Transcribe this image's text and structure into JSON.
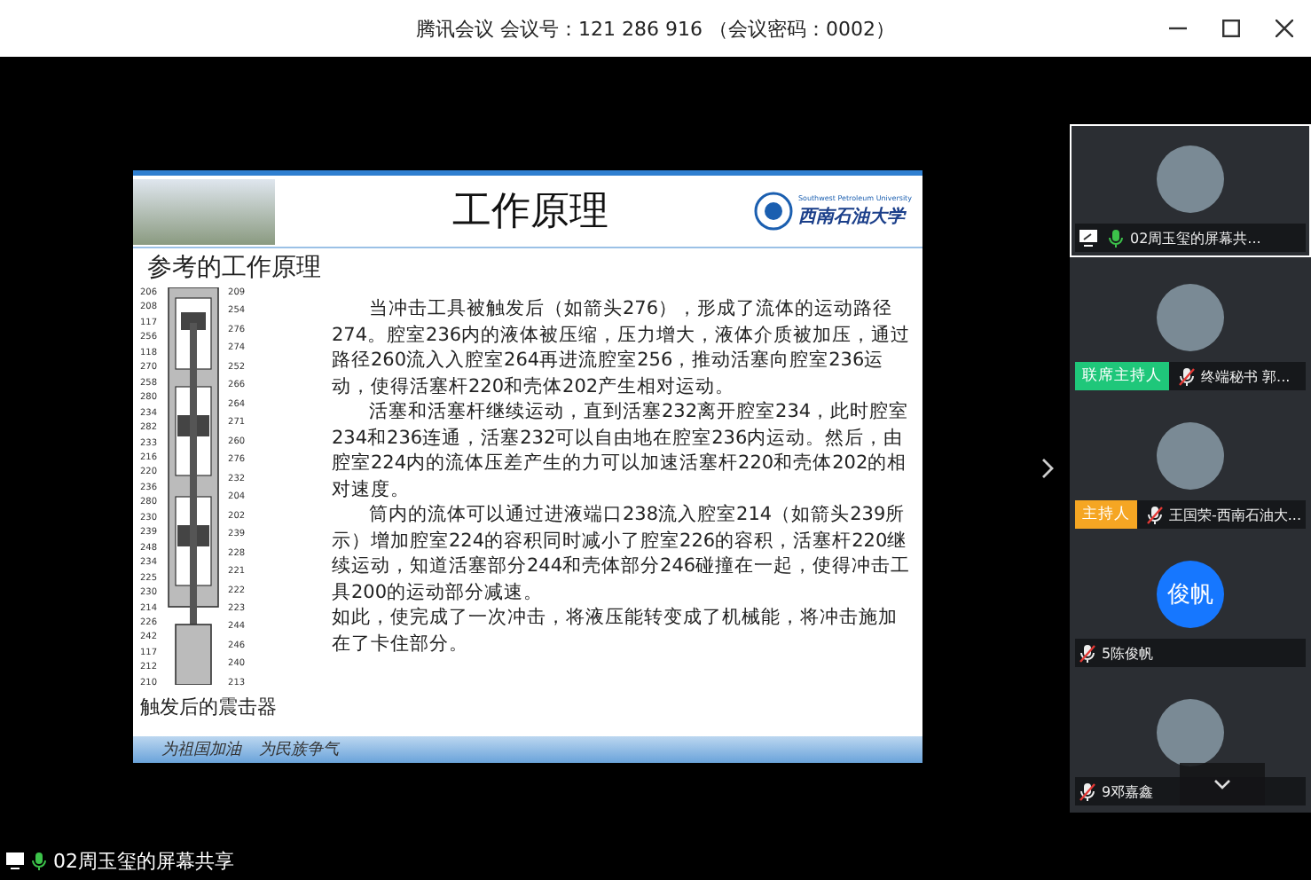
{
  "window": {
    "title": "腾讯会议 会议号：121 286 916 （会议密码：0002）"
  },
  "slide": {
    "title": "工作原理",
    "logo_name": "西南石油大学",
    "logo_subtitle": "Southwest Petroleum University",
    "heading": "参考的工作原理",
    "paragraphs": [
      "当冲击工具被触发后（如箭头276），形成了流体的运动路径274。腔室236内的液体被压缩，压力增大，液体介质被加压，通过路径260流入入腔室264再进流腔室256，推动活塞向腔室236运动，使得活塞杆220和壳体202产生相对运动。",
      "活塞和活塞杆继续运动，直到活塞232离开腔室234，此时腔室234和236连通，活塞232可以自由地在腔室236内运动。然后，由腔室224内的流体压差产生的力可以加速活塞杆220和壳体202的相对速度。",
      "筒内的流体可以通过进液端口238流入腔室214（如箭头239所示）增加腔室224的容积同时减小了腔室226的容积，活塞杆220继续运动，知道活塞部分244和壳体部分246碰撞在一起，使得冲击工具200的运动部分减速。",
      "如此，使完成了一次冲击，将液压能转变成了机械能，将冲击施加在了卡住部分。"
    ],
    "diagram": {
      "left_labels": [
        "206",
        "208",
        "117",
        "256",
        "118",
        "270",
        "258",
        "280",
        "234",
        "282",
        "233",
        "216",
        "220",
        "236",
        "280",
        "230",
        "239",
        "248",
        "234",
        "225",
        "230",
        "214",
        "226",
        "242",
        "117",
        "212",
        "210"
      ],
      "right_labels": [
        "209",
        "254",
        "276",
        "274",
        "252",
        "266",
        "264",
        "271",
        "260",
        "276",
        "232",
        "204",
        "202",
        "239",
        "228",
        "221",
        "222",
        "223",
        "244",
        "246",
        "240",
        "213"
      ]
    },
    "caption": "触发后的震击器",
    "slogans": [
      "为祖国加油",
      "为民族争气"
    ]
  },
  "participants": [
    {
      "name": "02周玉玺的屏幕共...",
      "muted": false,
      "screen_share": true,
      "selected": true
    },
    {
      "name": "终端秘书 郭...",
      "badge": {
        "kind": "cohost",
        "label": "联席主持人"
      },
      "muted": true,
      "screen_share": false,
      "selected": false
    },
    {
      "name": "王国荣-西南石油大...",
      "badge": {
        "kind": "host",
        "label": "主持人"
      },
      "muted": true,
      "screen_share": false,
      "selected": false
    },
    {
      "name": "5陈俊帆",
      "muted": true,
      "screen_share": false,
      "selected": false,
      "initials": "俊帆"
    },
    {
      "name": "9邓嘉鑫",
      "muted": true,
      "screen_share": false,
      "selected": false
    }
  ],
  "status_bar": {
    "label": "02周玉玺的屏幕共享",
    "muted": false
  }
}
